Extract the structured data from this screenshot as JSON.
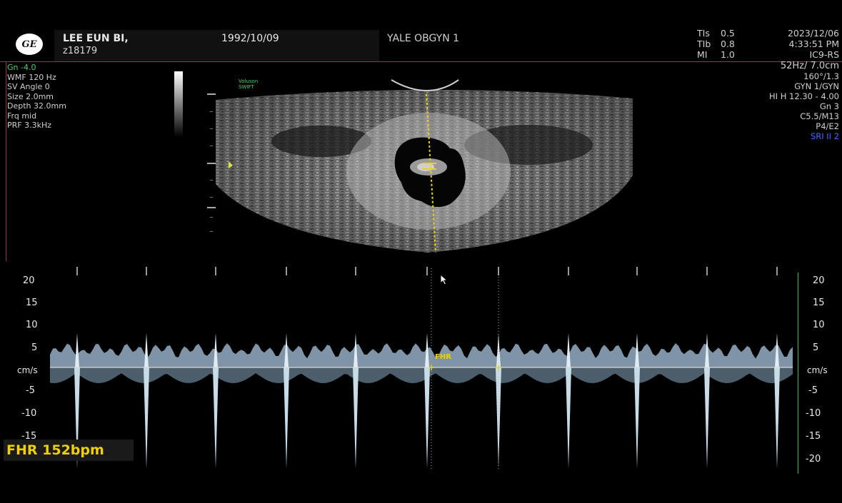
{
  "header": {
    "logo_text": "GE",
    "patient_name": "LEE EUN BI,",
    "patient_id": "z18179",
    "dob": "1992/10/09",
    "institution": "YALE OBGYN 1",
    "tis_label": "TIs",
    "tis_value": "0.5",
    "tib_label": "TIb",
    "tib_value": "0.8",
    "mi_label": "MI",
    "mi_value": "1.0",
    "date": "2023/12/06",
    "time": "4:33:51 PM",
    "probe": "IC9-RS"
  },
  "left_params": {
    "gain": "Gn -4.0",
    "wmf": "WMF 120 Hz",
    "sv_angle": "SV Angle  0",
    "size": "Size  2.0mm",
    "depth": "Depth 32.0mm",
    "frq": "Frq mid",
    "prf": "PRF  3.3kHz"
  },
  "right_params": {
    "frame": "52Hz/ 7.0cm",
    "angle": "160°/1.3",
    "preset": "GYN 1/GYN",
    "harmonic": "HI H  12.30 - 4.00",
    "gain": "Gn  3",
    "c_value": "C5.5/M13",
    "p_value": "P4/E2",
    "sri": "SRI II 2"
  },
  "voluson": {
    "line1": "Voluson",
    "line2": "SWIFT"
  },
  "doppler": {
    "unit": "cm/s",
    "ticks": [
      "20",
      "15",
      "10",
      "5",
      "-5",
      "-10",
      "-15",
      "-20"
    ],
    "caliper_label": "FHR",
    "fhr_result": "FHR 152bpm"
  },
  "colors": {
    "caliper": "#f0d000",
    "gain_green": "#4fd06a",
    "header_line": "#8a3a4a",
    "sri_blue": "#4a66ff"
  }
}
